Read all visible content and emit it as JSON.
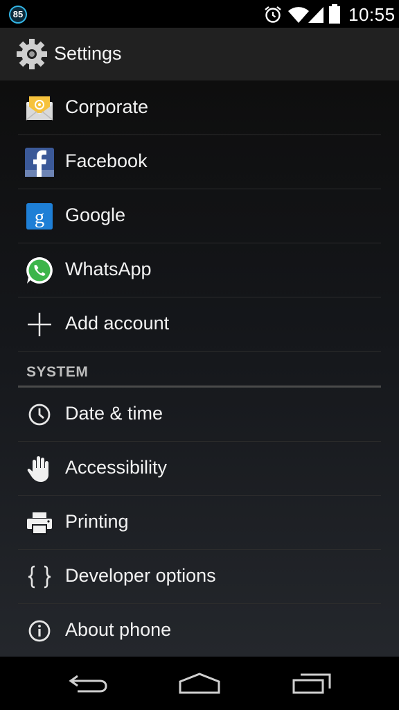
{
  "status_bar": {
    "notification_count": "85",
    "icons": [
      "alarm-icon",
      "wifi-icon",
      "signal-icon",
      "battery-icon"
    ],
    "time": "10:55"
  },
  "action_bar": {
    "icon": "gear-icon",
    "title": "Settings"
  },
  "accounts": [
    {
      "label": "Corporate",
      "icon": "corporate-email-icon"
    },
    {
      "label": "Facebook",
      "icon": "facebook-icon"
    },
    {
      "label": "Google",
      "icon": "google-icon"
    },
    {
      "label": "WhatsApp",
      "icon": "whatsapp-icon"
    },
    {
      "label": "Add account",
      "icon": "plus-icon"
    }
  ],
  "system": {
    "header": "SYSTEM",
    "items": [
      {
        "label": "Date & time",
        "icon": "clock-icon"
      },
      {
        "label": "Accessibility",
        "icon": "hand-icon"
      },
      {
        "label": "Printing",
        "icon": "printer-icon"
      },
      {
        "label": "Developer options",
        "icon": "braces-icon"
      },
      {
        "label": "About phone",
        "icon": "info-icon"
      }
    ]
  },
  "nav_bar": {
    "buttons": [
      "back-icon",
      "home-icon",
      "recents-icon"
    ]
  },
  "colors": {
    "accent": "#33b5e5",
    "action_bar": "#212121",
    "divider": "#2c2c2c"
  }
}
